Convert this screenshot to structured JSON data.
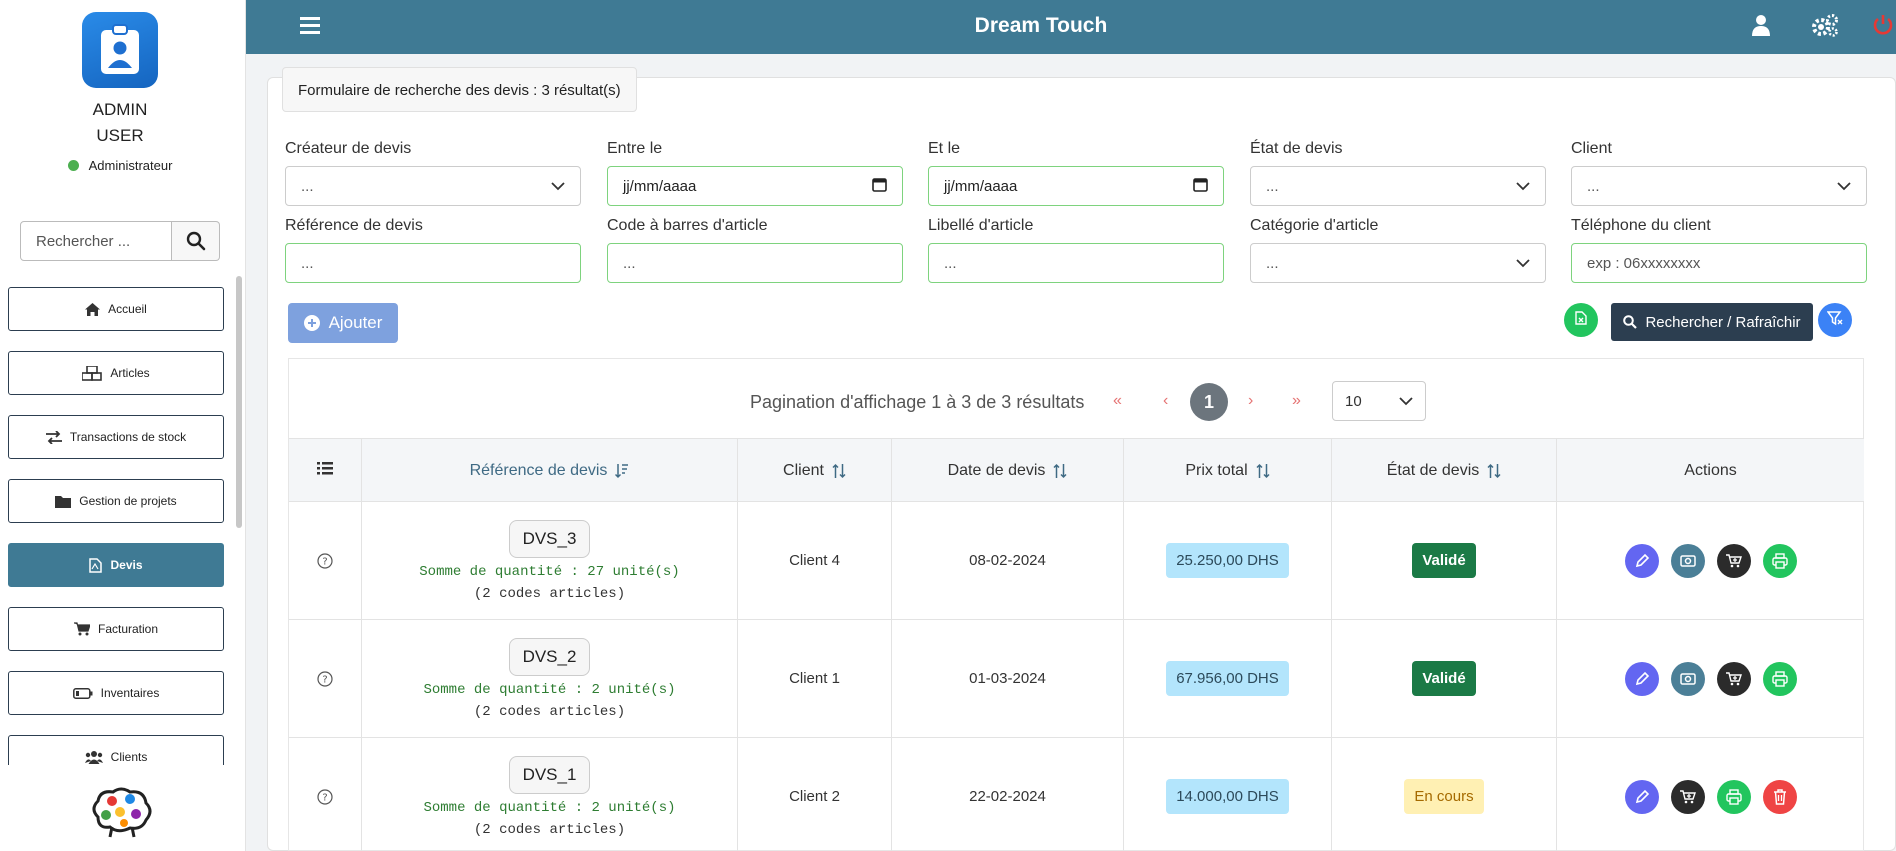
{
  "user": {
    "first": "ADMIN",
    "last": "USER",
    "role": "Administrateur"
  },
  "sidebar": {
    "search_placeholder": "Rechercher ...",
    "items": [
      {
        "label": "Accueil",
        "icon": "home-icon"
      },
      {
        "label": "Articles",
        "icon": "boxes-icon"
      },
      {
        "label": "Transactions de stock",
        "icon": "exchange-icon"
      },
      {
        "label": "Gestion de projets",
        "icon": "folder-icon"
      },
      {
        "label": "Devis",
        "icon": "pdf-icon"
      },
      {
        "label": "Facturation",
        "icon": "cart-icon"
      },
      {
        "label": "Inventaires",
        "icon": "battery-icon"
      },
      {
        "label": "Clients",
        "icon": "users-icon"
      }
    ]
  },
  "header": {
    "title": "Dream Touch"
  },
  "form": {
    "title": "Formulaire de recherche des devis : 3 résultat(s)",
    "createur": {
      "label": "Créateur de devis",
      "value": "..."
    },
    "entre": {
      "label": "Entre le",
      "value": "jj/mm/aaaa"
    },
    "etle": {
      "label": "Et le",
      "value": "jj/mm/aaaa"
    },
    "etat": {
      "label": "État de devis",
      "value": "..."
    },
    "client": {
      "label": "Client",
      "value": "..."
    },
    "reference": {
      "label": "Référence de devis",
      "value": "..."
    },
    "barcode": {
      "label": "Code à barres d'article",
      "value": "..."
    },
    "libelle": {
      "label": "Libellé d'article",
      "value": "..."
    },
    "categorie": {
      "label": "Catégorie d'article",
      "value": "..."
    },
    "telephone": {
      "label": "Téléphone du client",
      "placeholder": "exp : 06xxxxxxxx"
    },
    "add_label": "Ajouter",
    "search_label": "Rechercher / Rafraîchir"
  },
  "pagination": {
    "text": "Pagination d'affichage 1 à 3 de 3 résultats",
    "first": "«",
    "prev": "‹",
    "current": "1",
    "next": "›",
    "last": "»",
    "page_size": "10"
  },
  "table": {
    "headers": {
      "reference": "Référence de devis",
      "client": "Client",
      "date": "Date de devis",
      "prix": "Prix total",
      "etat": "État de devis",
      "actions": "Actions"
    },
    "rows": [
      {
        "ref": "DVS_3",
        "qty": "Somme de quantité : 27 unité(s)",
        "codes": "(2 codes articles)",
        "client": "Client 4",
        "date": "08-02-2024",
        "prix": "25.250,00 DHS",
        "etat": "Validé"
      },
      {
        "ref": "DVS_2",
        "qty": "Somme de quantité : 2 unité(s)",
        "codes": "(2 codes articles)",
        "client": "Client 1",
        "date": "01-03-2024",
        "prix": "67.956,00 DHS",
        "etat": "Validé"
      },
      {
        "ref": "DVS_1",
        "qty": "Somme de quantité : 2 unité(s)",
        "codes": "(2 codes articles)",
        "client": "Client 2",
        "date": "22-02-2024",
        "prix": "14.000,00 DHS",
        "etat": "En cours"
      }
    ]
  },
  "colors": {
    "primary": "#3f7a94",
    "dark": "#2c3e50",
    "green": "#22c55e",
    "purple": "#6366f1",
    "red": "#ef4444"
  }
}
